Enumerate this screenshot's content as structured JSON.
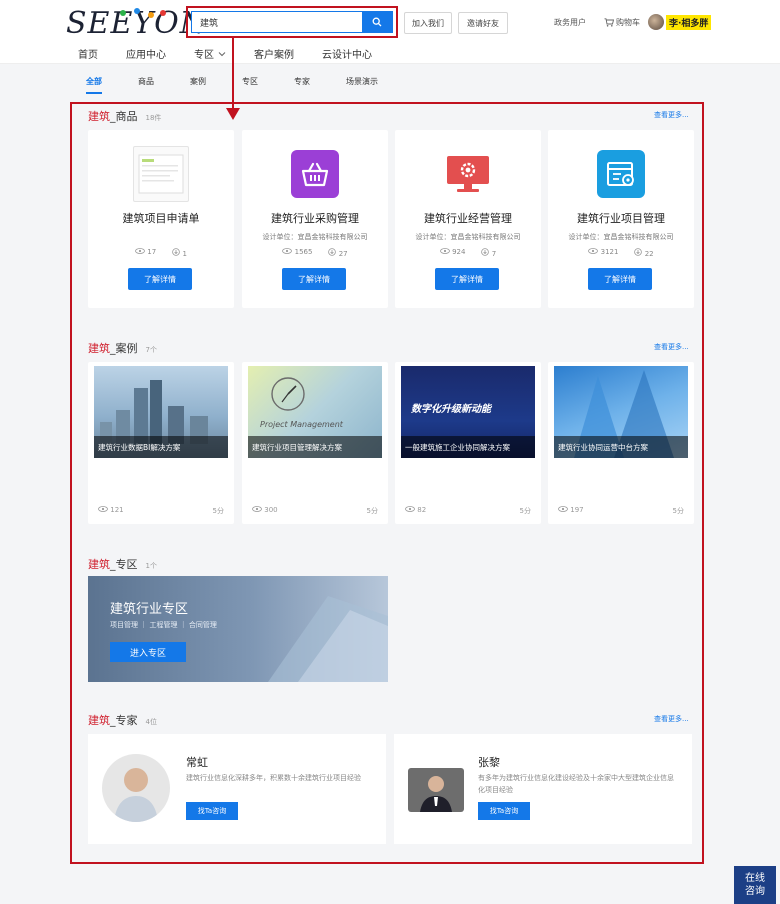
{
  "header": {
    "logo_text": "SEEYON",
    "logo_tm": "TM",
    "search": {
      "value": "建筑",
      "placeholder": ""
    },
    "join_label": "加入我们",
    "invite_label": "邀请好友",
    "gov_user_label": "政务用户",
    "cart_label": "购物车",
    "user_name": "李·相多胖"
  },
  "nav": {
    "items": [
      "首页",
      "应用中心",
      "专区",
      "客户案例",
      "云设计中心"
    ]
  },
  "subtabs": {
    "items": [
      "全部",
      "商品",
      "案例",
      "专区",
      "专家",
      "场景演示"
    ],
    "active": "全部"
  },
  "products": {
    "keyword": "建筑",
    "title": "_商品",
    "count": "18件",
    "more": "查看更多...",
    "items": [
      {
        "name": "建筑项目申请单",
        "designer": "",
        "views": "17",
        "uses": "1",
        "button": "了解详情",
        "icon": "form-thumbnail-icon",
        "color": "#f2f2f2"
      },
      {
        "name": "建筑行业采购管理",
        "designer": "设计单位：宜昌金铭科技有限公司",
        "views": "1565",
        "uses": "27",
        "button": "了解详情",
        "icon": "basket-icon",
        "color": "#9b3fd6"
      },
      {
        "name": "建筑行业经营管理",
        "designer": "设计单位：宜昌金铭科技有限公司",
        "views": "924",
        "uses": "7",
        "button": "了解详情",
        "icon": "monitor-gear-icon",
        "color": "#e34f4f"
      },
      {
        "name": "建筑行业项目管理",
        "designer": "设计单位：宜昌金铭科技有限公司",
        "views": "3121",
        "uses": "22",
        "button": "了解详情",
        "icon": "folder-gear-icon",
        "color": "#1a9ee0"
      }
    ]
  },
  "cases": {
    "keyword": "建筑",
    "title": "_案例",
    "count": "7个",
    "more": "查看更多...",
    "items": [
      {
        "caption": "建筑行业数据BI解决方案",
        "views": "121",
        "score": "5分",
        "img_text": ""
      },
      {
        "caption": "建筑行业项目管理解决方案",
        "views": "300",
        "score": "5分",
        "img_text": "Project Management"
      },
      {
        "caption": "一般建筑施工企业协同解决方案",
        "views": "82",
        "score": "5分",
        "img_text": "数字化升级新动能"
      },
      {
        "caption": "建筑行业协同运营中台方案",
        "views": "197",
        "score": "5分",
        "img_text": ""
      }
    ]
  },
  "zone": {
    "keyword": "建筑",
    "title": "_专区",
    "count": "1个",
    "banner_title": "建筑行业专区",
    "tags": "项目管理 ｜ 工程管理 ｜ 合同管理",
    "button": "进入专区"
  },
  "experts": {
    "keyword": "建筑",
    "title": "_专家",
    "count": "4位",
    "more": "查看更多...",
    "items": [
      {
        "name": "常虹",
        "desc": "建筑行业信息化深耕多年，积累数十余建筑行业项目经验",
        "button": "找Ta咨询"
      },
      {
        "name": "张黎",
        "desc": "有多年为建筑行业信息化建设经验及十余家中大型建筑企业信息化项目经验",
        "button": "找Ta咨询"
      }
    ]
  },
  "online": {
    "line1": "在线",
    "line2": "咨询"
  }
}
